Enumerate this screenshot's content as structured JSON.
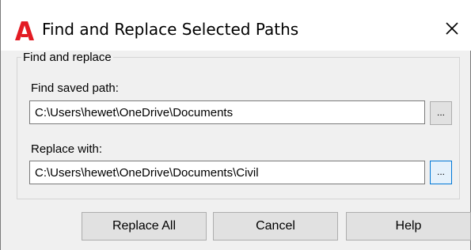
{
  "window": {
    "title": "Find and Replace Selected Paths",
    "app_icon": "autocad-logo-icon",
    "close_icon": "close-icon",
    "accent_color": "#e31b23"
  },
  "group": {
    "label": "Find and replace"
  },
  "find_field": {
    "label": "Find saved path:",
    "value": "C:\\Users\\hewet\\OneDrive\\Documents",
    "browse_label": "..."
  },
  "replace_field": {
    "label": "Replace with:",
    "value": "C:\\Users\\hewet\\OneDrive\\Documents\\Civil",
    "browse_label": "..."
  },
  "buttons": {
    "replace_all": "Replace All",
    "cancel": "Cancel",
    "help": "Help"
  }
}
